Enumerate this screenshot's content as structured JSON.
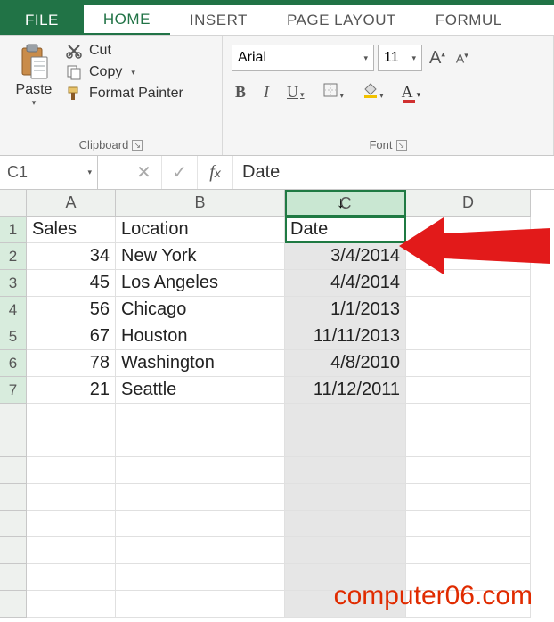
{
  "tabs": {
    "file": "FILE",
    "home": "HOME",
    "insert": "INSERT",
    "pagelayout": "PAGE LAYOUT",
    "formulas": "FORMUL"
  },
  "clipboard": {
    "paste": "Paste",
    "cut": "Cut",
    "copy": "Copy",
    "format_painter": "Format Painter",
    "group_label": "Clipboard"
  },
  "font": {
    "name": "Arial",
    "size": "11",
    "group_label": "Font"
  },
  "name_box": "C1",
  "formula_value": "Date",
  "columns": {
    "A": "A",
    "B": "B",
    "C": "C",
    "D": "D"
  },
  "rows": [
    "1",
    "2",
    "3",
    "4",
    "5",
    "6",
    "7"
  ],
  "data": {
    "A": [
      "Sales",
      "34",
      "45",
      "56",
      "67",
      "78",
      "21"
    ],
    "B": [
      "Location",
      "New York",
      "Los Angeles",
      "Chicago",
      "Houston",
      "Washington",
      "Seattle"
    ],
    "C": [
      "Date",
      "3/4/2014",
      "4/4/2014",
      "1/1/2013",
      "11/11/2013",
      "4/8/2010",
      "11/12/2011"
    ]
  },
  "watermark": "computer06.com"
}
